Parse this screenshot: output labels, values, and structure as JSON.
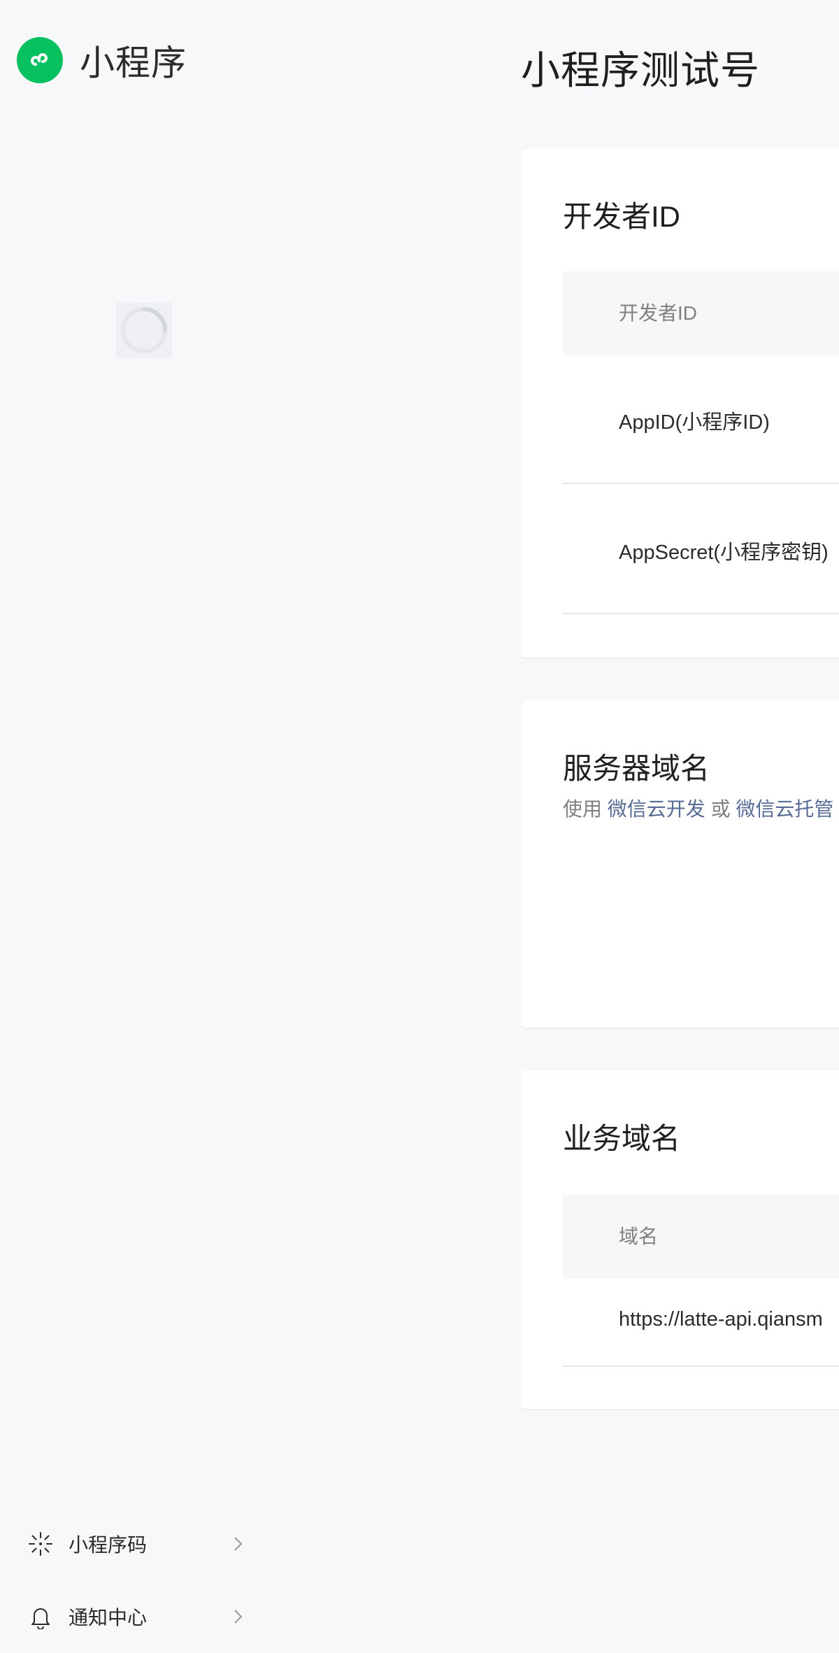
{
  "brand": {
    "name": "小程序",
    "accent": "#07c160"
  },
  "page": {
    "title": "小程序测试号"
  },
  "developer_id": {
    "title": "开发者ID",
    "header": "开发者ID",
    "rows": [
      {
        "label": "AppID(小程序ID)"
      },
      {
        "label": "AppSecret(小程序密钥)"
      }
    ]
  },
  "server_domain": {
    "title": "服务器域名",
    "desc_prefix": "使用",
    "link_cloud_dev": "微信云开发",
    "desc_or": "或",
    "link_cloud_hosting": "微信云托管"
  },
  "business_domain": {
    "title": "业务域名",
    "header": "域名",
    "rows": [
      {
        "value": "https://latte-api.qiansm"
      }
    ]
  },
  "side_nav": {
    "items": [
      {
        "label": "小程序码",
        "icon": "qrcode-sparkle-icon"
      },
      {
        "label": "通知中心",
        "icon": "bell-icon"
      }
    ]
  },
  "colors": {
    "link": "#576b95",
    "background": "#f7f8fa"
  }
}
